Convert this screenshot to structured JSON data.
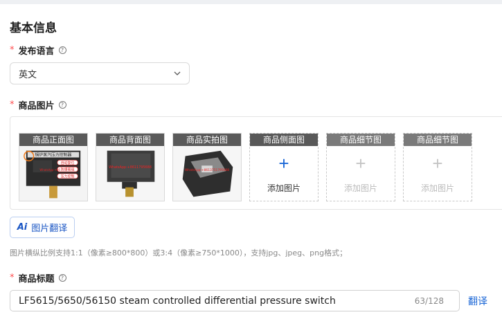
{
  "section": {
    "title": "基本信息"
  },
  "language": {
    "label": "发布语言",
    "required_mark": "*",
    "help_icon": "question-circle-icon",
    "value": "英文",
    "chevron_icon": "chevron-down-icon"
  },
  "images": {
    "label": "商品图片",
    "required_mark": "*",
    "help_icon": "question-circle-icon",
    "slots": [
      {
        "caption": "商品正面图",
        "state": "filled",
        "overlay_text": "锅炉蒸汽压力控制器",
        "tags": [
          "自动复位",
          "防爆玻璃",
          "压力控制"
        ],
        "watermark": "WhatsApp:+86"
      },
      {
        "caption": "商品背面图",
        "state": "filled",
        "watermark": "WhatsApp:+8611795688"
      },
      {
        "caption": "商品实拍图",
        "state": "filled",
        "watermark": "WhatsApp:+8613751795688"
      },
      {
        "caption": "商品侧面图",
        "state": "empty-active",
        "plus": "+",
        "add_label": "添加图片"
      },
      {
        "caption": "商品细节图",
        "state": "empty-disabled",
        "plus": "+",
        "add_label": "添加图片"
      },
      {
        "caption": "商品细节图",
        "state": "empty-disabled",
        "plus": "+",
        "add_label": "添加图片"
      }
    ],
    "translate_button": {
      "icon_text": "Ai",
      "label": "图片翻译"
    },
    "hint": "图片横纵比例支持1:1（像素≥800*800）或3:4（像素≥750*1000），支持jpg、jpeg、png格式；"
  },
  "product_title": {
    "label": "商品标题",
    "required_mark": "*",
    "help_icon": "question-circle-icon",
    "value": "LF5615/5650/56150 steam controlled differential pressure switch",
    "counter": "63/128",
    "translate_link": "翻译"
  },
  "colors": {
    "accent": "#1a66d6",
    "required": "#ff4d4f",
    "caption_bg": "#5a5a5a"
  }
}
